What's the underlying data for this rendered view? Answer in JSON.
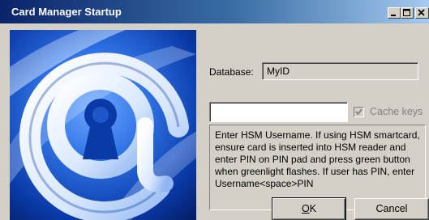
{
  "window": {
    "title": "Card Manager Startup",
    "controls": {
      "minimize": "minimize-icon",
      "maximize": "maximize-icon",
      "close": "close-icon"
    }
  },
  "logo": {
    "icon": "keyhole-at-logo"
  },
  "form": {
    "database_label": "Database:",
    "database_value": "MyID",
    "username_value": "",
    "cache_keys_label": "Cache keys",
    "cache_keys_checked": true,
    "instructions": "Enter HSM Username. If using HSM smartcard, ensure card is inserted into HSM reader and enter PIN on PIN pad and press green button when greenlight flashes. If user has PIN, enter Username<space>PIN"
  },
  "buttons": {
    "ok_prefix": "",
    "ok_mnemonic": "O",
    "ok_rest": "K",
    "cancel_label": "Cancel"
  },
  "colors": {
    "title_gradient_start": "#0a246a",
    "title_gradient_end": "#a6caf0",
    "face": "#d4d0c8",
    "logo_blue": "#1a5fd0"
  }
}
